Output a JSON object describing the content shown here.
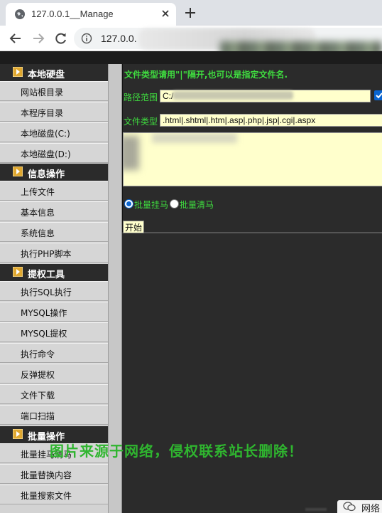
{
  "browser": {
    "tab_title": "127.0.0.1__Manage",
    "address": "127.0.0."
  },
  "sidebar": {
    "sections": [
      {
        "title": "本地硬盘",
        "items": [
          "网站根目录",
          "本程序目录",
          "本地磁盘(C:)",
          "本地磁盘(D:)"
        ]
      },
      {
        "title": "信息操作",
        "items": [
          "上传文件",
          "基本信息",
          "系统信息",
          "执行PHP脚本"
        ]
      },
      {
        "title": "提权工具",
        "items": [
          "执行SQL执行",
          "MYSQL操作",
          "MYSQL提权",
          "执行命令",
          "反弹提权",
          "文件下载",
          "端口扫描"
        ]
      },
      {
        "title": "批量操作",
        "items": [
          "批量挂马清马",
          "批量替换内容",
          "批量搜索文件"
        ]
      }
    ]
  },
  "form": {
    "hint": "文件类型请用\"|\"隔开,也可以是指定文件名.",
    "path_label": "路径范围",
    "path_value": "C:/",
    "type_label": "文件类型",
    "type_value": ".html|.shtml|.htm|.asp|.php|.jsp|.cgi|.aspx",
    "radio_options": [
      "批量挂马",
      "批量清马"
    ],
    "selected_radio": "批量挂马",
    "start_label": "开始"
  },
  "overlay": {
    "watermark": "图片来源于网络，侵权联系站长删除！",
    "brand_text": "网络"
  },
  "colors": {
    "accent_green": "#3fdc3f",
    "input_bg": "#ffffcc",
    "page_bg": "#2b2b2b"
  }
}
